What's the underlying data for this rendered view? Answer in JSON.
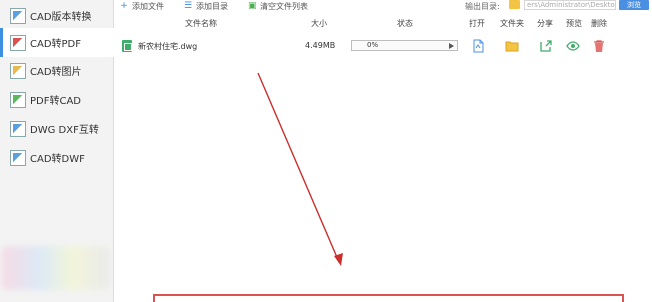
{
  "sidebar": {
    "items": [
      {
        "label": "CAD版本转换",
        "icon": "cad-version-icon"
      },
      {
        "label": "CAD转PDF",
        "icon": "cad-to-pdf-icon"
      },
      {
        "label": "CAD转图片",
        "icon": "cad-to-image-icon"
      },
      {
        "label": "PDF转CAD",
        "icon": "pdf-to-cad-icon"
      },
      {
        "label": "DWG DXF互转",
        "icon": "dwg-dxf-icon"
      },
      {
        "label": "CAD转DWF",
        "icon": "cad-to-dwf-icon"
      }
    ],
    "active_index": 1
  },
  "toolbar": {
    "add_file": "添加文件",
    "add_dir": "添加目录",
    "clear_list": "清空文件列表",
    "output_label": "输出目录:",
    "output_path": "ers\\Administrator\\Desktop",
    "browse": "浏览"
  },
  "table": {
    "headers": {
      "name": "文件名称",
      "size": "大小",
      "status": "状态",
      "open": "打开",
      "folder": "文件夹",
      "share": "分享",
      "preview": "预览",
      "delete": "删除"
    },
    "rows": [
      {
        "name": "新农村住宅.dwg",
        "size": "4.49MB",
        "progress_text": "0%",
        "progress": 0
      }
    ]
  },
  "colors": {
    "accent": "#4a90e2",
    "annotation_red": "#d9534f",
    "folder_yellow": "#f3c343",
    "file_green": "#3fae6a"
  }
}
